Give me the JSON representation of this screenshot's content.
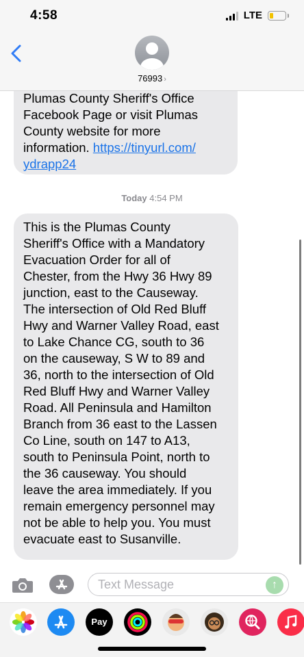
{
  "status_bar": {
    "time": "4:58",
    "network": "LTE"
  },
  "header": {
    "contact": "76993",
    "contact_chevron": "›"
  },
  "messages": {
    "first": {
      "text": "Plumas County Sheriff's Office\nFacebook Page or visit Plumas\nCounty website for more\ninformation. ",
      "link": "https://tinyurl.com/\nydrapp24"
    },
    "timestamp": {
      "day": "Today",
      "time": " 4:54 PM"
    },
    "second": {
      "text": "This is the Plumas County\nSheriff's Office with a Mandatory\nEvacuation Order for all of\nChester, from the Hwy 36 Hwy 89\njunction, east to the Causeway.\nThe intersection of Old Red Bluff\nHwy and Warner Valley Road, east\nto Lake Chance CG, south to 36\non the causeway, S W to 89 and\n36, north to the intersection of Old\nRed Bluff Hwy and Warner Valley\nRoad. All Peninsula and Hamilton\nBranch from 36 east to the Lassen\nCo Line, south on 147 to A13,\nsouth to Peninsula Point, north to\nthe 36 causeway. You should\nleave the area immediately.  If you\nremain emergency personnel may\nnot be able to help you. You must\nevacuate east to Susanville."
    }
  },
  "input": {
    "placeholder": "Text Message",
    "send_glyph": "↑"
  },
  "app_strip": {
    "items": [
      {
        "name": "photos-app-icon",
        "label": ""
      },
      {
        "name": "app-store-icon",
        "label": ""
      },
      {
        "name": "apple-pay-icon",
        "label": "Pay"
      },
      {
        "name": "activity-rings-icon",
        "label": ""
      },
      {
        "name": "memoji-icon-1",
        "label": ""
      },
      {
        "name": "memoji-icon-2",
        "label": ""
      },
      {
        "name": "web-search-icon",
        "label": ""
      },
      {
        "name": "music-icon",
        "label": ""
      }
    ]
  },
  "colors": {
    "header_bg": "#f6f6f6",
    "bubble_gray": "#e9e9eb",
    "link_blue": "#1a73e8",
    "ios_blue": "#2f7cf6",
    "send_green": "#a8dcae",
    "battery_yellow": "#f2c200"
  }
}
